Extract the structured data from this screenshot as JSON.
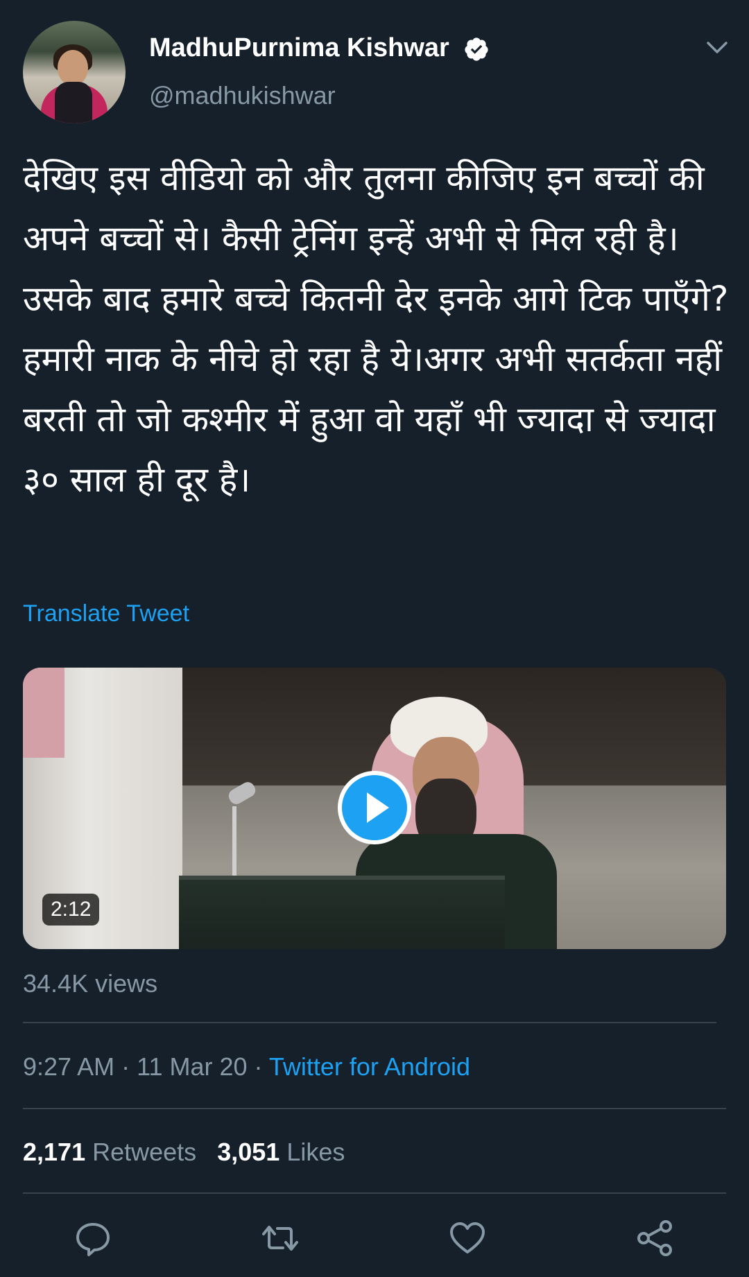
{
  "user": {
    "display_name": "MadhuPurnima Kishwar",
    "handle": "@madhukishwar",
    "verified": true
  },
  "tweet": {
    "text": "देखिए इस वीडियो को और तुलना कीजिए इन बच्चों की अपने बच्चों से। कैसी ट्रेनिंग इन्हें अभी से मिल रही है। उसके बाद हमारे बच्चे कितनी देर इनके आगे टिक पाएँगे? हमारी नाक के नीचे हो रहा है ये।अगर अभी सतर्कता नहीं बरती तो जो कश्मीर में हुआ वो यहाँ भी ज्यादा से ज्यादा ३० साल ही दूर है।",
    "translate_label": "Translate Tweet"
  },
  "video": {
    "duration": "2:12",
    "views": "34.4K views"
  },
  "meta": {
    "time": "9:27 AM",
    "separator": " · ",
    "date": "11 Mar 20",
    "source": "Twitter for Android"
  },
  "stats": {
    "retweets_count": "2,171",
    "retweets_label": "Retweets",
    "likes_count": "3,051",
    "likes_label": "Likes"
  },
  "actions": {
    "reply_icon": "reply-icon",
    "retweet_icon": "retweet-icon",
    "like_icon": "heart-icon",
    "share_icon": "share-icon"
  },
  "colors": {
    "background": "#15202b",
    "accent": "#1da1f2",
    "secondary_text": "#8899a6",
    "divider": "#38444d"
  }
}
